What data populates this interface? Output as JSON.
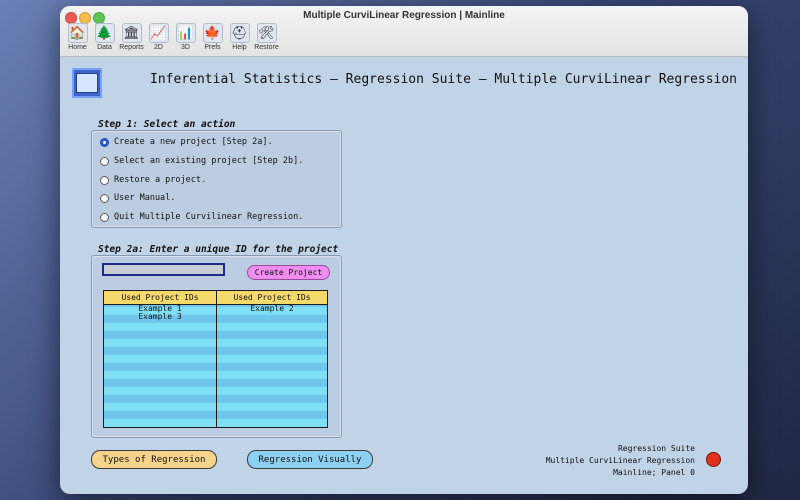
{
  "window": {
    "title": "Multiple CurviLinear Regression | Mainline"
  },
  "toolbar": {
    "items": [
      {
        "label": "Home",
        "icon": "home-icon"
      },
      {
        "label": "Data",
        "icon": "tree-icon"
      },
      {
        "label": "Reports",
        "icon": "bank-icon"
      },
      {
        "label": "2D",
        "icon": "line-chart-icon"
      },
      {
        "label": "3D",
        "icon": "bar-chart-icon"
      },
      {
        "label": "Prefs",
        "icon": "leaf-icon"
      },
      {
        "label": "Help",
        "icon": "helmet-icon"
      },
      {
        "label": "Restore",
        "icon": "tools-icon"
      }
    ]
  },
  "header": {
    "title": "Inferential Statistics — Regression Suite — Multiple CurviLinear Regression"
  },
  "step1": {
    "title": "Step 1: Select an action",
    "options": [
      {
        "label": "Create a new project [Step 2a].",
        "selected": true
      },
      {
        "label": "Select an existing project [Step 2b].",
        "selected": false
      },
      {
        "label": "Restore a project.",
        "selected": false
      },
      {
        "label": "User Manual.",
        "selected": false
      },
      {
        "label": "Quit Multiple Curvilinear Regression.",
        "selected": false
      }
    ]
  },
  "step2a": {
    "title": "Step 2a: Enter a unique ID for the project",
    "input_value": "",
    "create_label": "Create Project",
    "table": {
      "headers": [
        "Used Project IDs",
        "Used Project IDs"
      ],
      "col1": [
        "Example 1",
        "Example 3"
      ],
      "col2": [
        "Example 2"
      ]
    }
  },
  "buttons": {
    "types": "Types of Regression",
    "visual": "Regression Visually"
  },
  "status": {
    "line1": "Regression Suite",
    "line2": "Multiple CurviLinear Regression",
    "line3": "Mainline; Panel 0",
    "dot_color": "#e0311f"
  }
}
